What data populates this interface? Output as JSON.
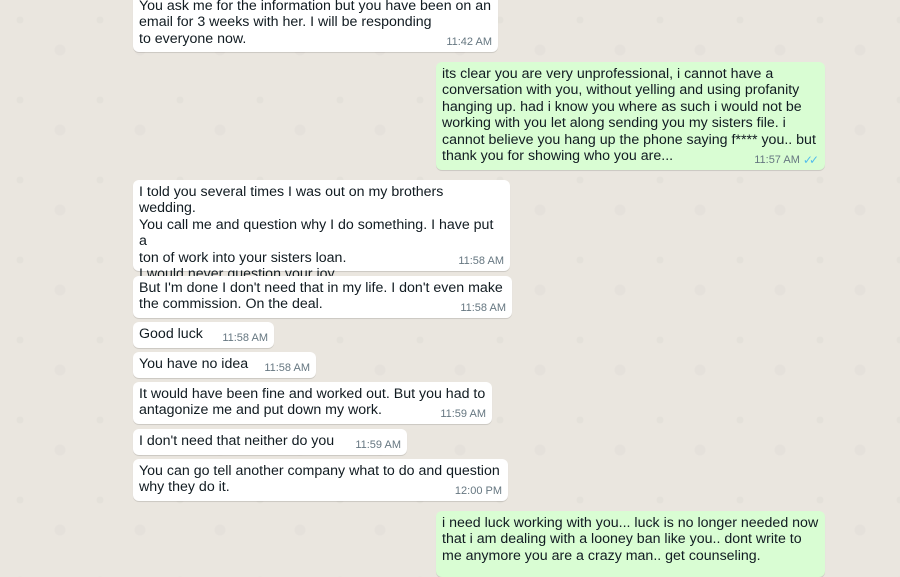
{
  "messages": [
    {
      "dir": "in",
      "text": "You ask me for the information but you have been on an\nemail for 3 weeks with her. I will be responding\nto everyone now.",
      "time": "11:42 AM"
    },
    {
      "dir": "out",
      "text": "its clear you are very unprofessional, i cannot have a\nconversation with you, without yelling and using profanity\nhanging up. had i know you where as such i would not be\nworking with you let along sending you my sisters file. i\ncannot believe you hang up the phone saying f**** you.. but\nthank you for showing who you are...",
      "time": "11:57 AM",
      "status_icon": "double-check-read-icon"
    },
    {
      "dir": "in",
      "text": "I told you several times I was out on my brothers wedding.\nYou call me and question why I do something. I have put a\nton of work into your sisters loan.\nI would never question your joy\nFor that I said fuck this not fuck you",
      "time": "11:58 AM"
    },
    {
      "dir": "in",
      "text": "But I'm done I don't need that in my life. I don't even make\nthe commission. On the deal.",
      "time": "11:58 AM"
    },
    {
      "dir": "in",
      "text": "Good luck",
      "time": "11:58 AM"
    },
    {
      "dir": "in",
      "text": "You have no idea",
      "time": "11:58 AM"
    },
    {
      "dir": "in",
      "text": "It would have been fine and worked out. But you had to\nantagonize me and put down my work.",
      "time": "11:59 AM"
    },
    {
      "dir": "in",
      "text": "I don't need that neither do you",
      "time": "11:59 AM"
    },
    {
      "dir": "in",
      "text": "You can go tell another company what to do and question\nwhy they do it.",
      "time": "12:00 PM"
    },
    {
      "dir": "out",
      "text": "i need luck working with you... luck is no longer needed now\nthat i am dealing with a looney ban like you.. dont write to\nme anymore you are a crazy man.. get counseling.",
      "time": ""
    }
  ]
}
